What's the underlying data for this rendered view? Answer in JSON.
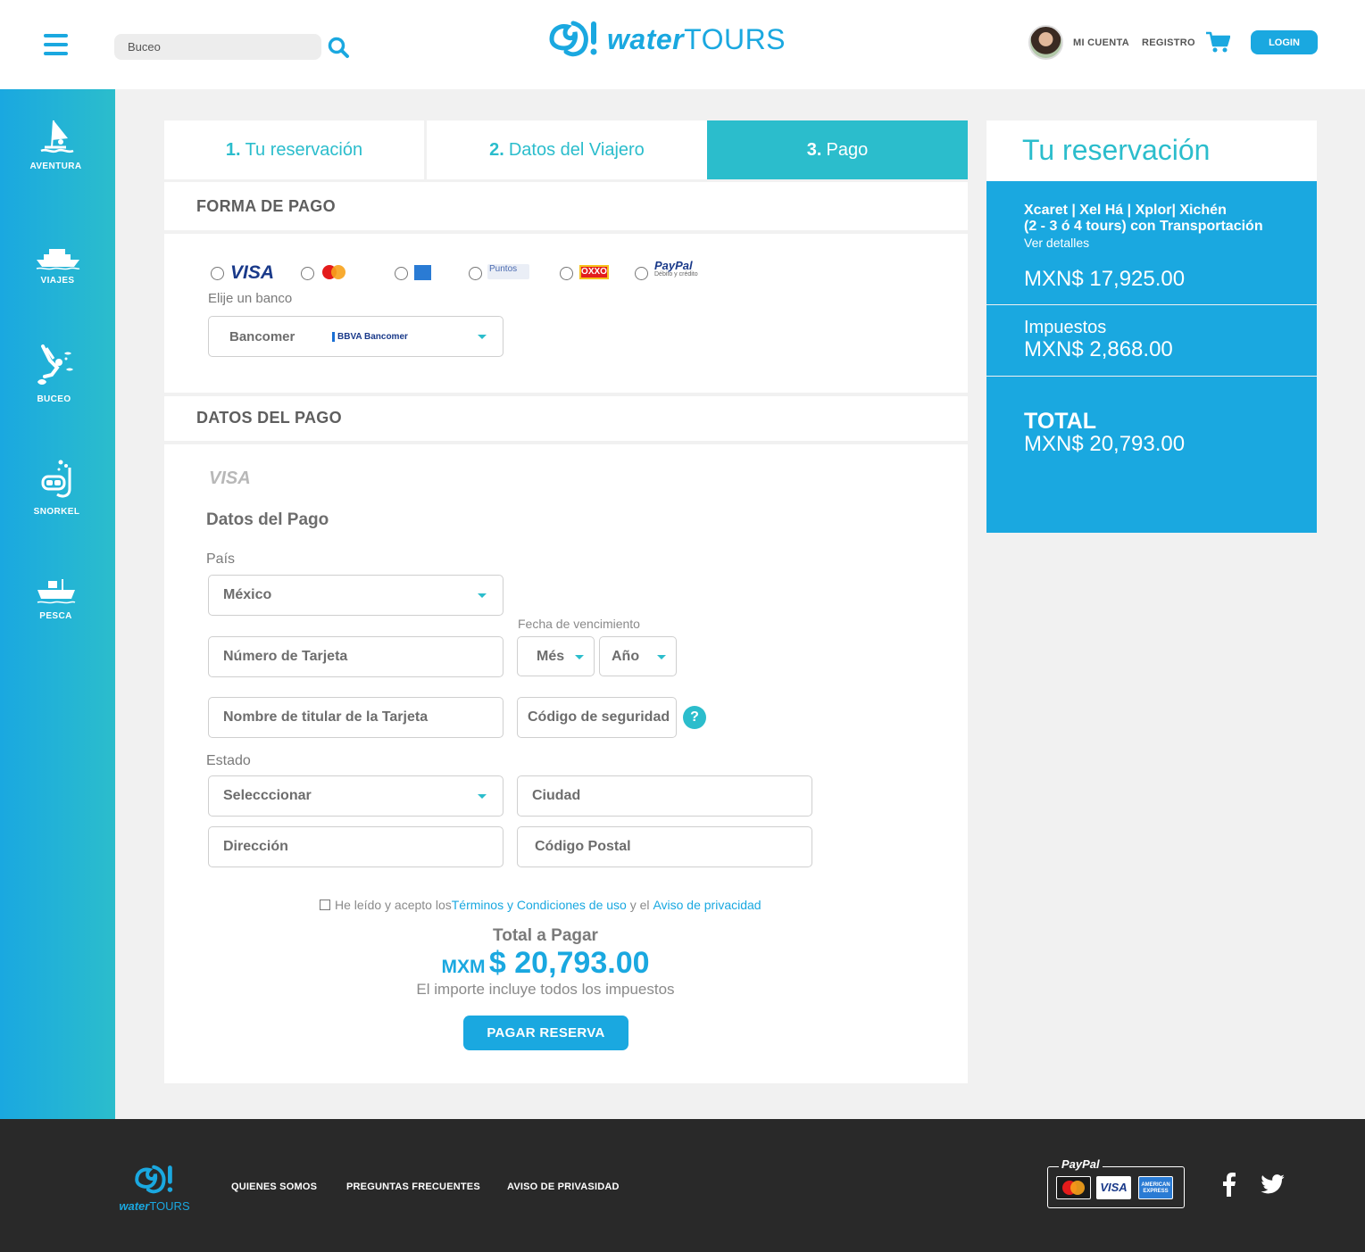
{
  "header": {
    "search_value": "Buceo",
    "logo_mark": "W!",
    "logo_water": "water",
    "logo_tours": "TOURS",
    "account_label": "MI CUENTA",
    "register_label": "REGISTRO",
    "login_label": "LOGIN"
  },
  "sidebar": {
    "items": [
      {
        "label": "AVENTURA",
        "icon": "windsurf-icon"
      },
      {
        "label": "VIAJES",
        "icon": "boat-icon"
      },
      {
        "label": "BUCEO",
        "icon": "diver-icon"
      },
      {
        "label": "SNORKEL",
        "icon": "snorkel-icon"
      },
      {
        "label": "PESCA",
        "icon": "fishing-boat-icon"
      }
    ]
  },
  "steps": [
    {
      "num": "1.",
      "label": "Tu reservación"
    },
    {
      "num": "2.",
      "label": "Datos del Viajero"
    },
    {
      "num": "3.",
      "label": "Pago"
    }
  ],
  "payment_method": {
    "title": "FORMA DE PAGO",
    "options": [
      "VISA",
      "MasterCard",
      "American Express",
      "Puntos BBVA Bancomer",
      "OXXO",
      "PayPal"
    ],
    "paypal_label": "PayPal",
    "paypal_sub": "Débito y crédito",
    "puntos_label": "Puntos",
    "puntos_sub": "BBVA Bancomer",
    "oxxo_label": "OXXO",
    "visa_label": "VISA",
    "mc_label": "MasterCard",
    "bank_label": "Elije un banco",
    "bank_value": "Bancomer",
    "bank_logo": "BBVA Bancomer"
  },
  "payment_data": {
    "title": "DATOS DEL PAGO",
    "card_brand": "VISA",
    "subtitle": "Datos del Pago",
    "country_label": "País",
    "country_value": "México",
    "expiry_label": "Fecha de vencimiento",
    "card_number_placeholder": "Número de Tarjeta",
    "month_label": "Més",
    "year_label": "Año",
    "holder_placeholder": "Nombre de titular de la Tarjeta",
    "cvv_placeholder": "Código de seguridad",
    "help": "?",
    "state_label": "Estado",
    "state_value": "Selecccionar",
    "city_placeholder": "Ciudad",
    "address_placeholder": "Dirección",
    "zip_placeholder": "Código Postal",
    "terms_prefix": "He leído y acepto los",
    "terms_link": "Términos y Condiciones de uso",
    "terms_mid": " y el ",
    "privacy_link": "Aviso de privacidad",
    "total_label": "Total a Pagar",
    "currency": "MXM",
    "total_amount": "$ 20,793.00",
    "total_note": "El importe incluye todos los impuestos",
    "pay_button": "PAGAR RESERVA"
  },
  "summary": {
    "title": "Tu reservación",
    "tour_line1": "Xcaret | Xel Há | Xplor| Xichén",
    "tour_line2": "(2 - 3 ó 4 tours) con Transportación",
    "details_link": "Ver detalles",
    "tour_price": "MXN$ 17,925.00",
    "tax_label": "Impuestos",
    "tax_value": "MXN$ 2,868.00",
    "total_label": "TOTAL",
    "total_value": "MXN$ 20,793.00"
  },
  "footer": {
    "logo_water": "water",
    "logo_tours": "TOURS",
    "links": [
      "QUIENES SOMOS",
      "PREGUNTAS FRECUENTES",
      "AVISO DE PRIVASIDAD"
    ],
    "paypal_label": "PayPal",
    "mc_label": "MasterCard",
    "visa_label": "VISA",
    "amex_label": "AMERICAN EXPRESS"
  },
  "colors": {
    "brand_blue": "#1aa8e0",
    "teal": "#2bbdcc",
    "footer_bg": "#292929"
  }
}
